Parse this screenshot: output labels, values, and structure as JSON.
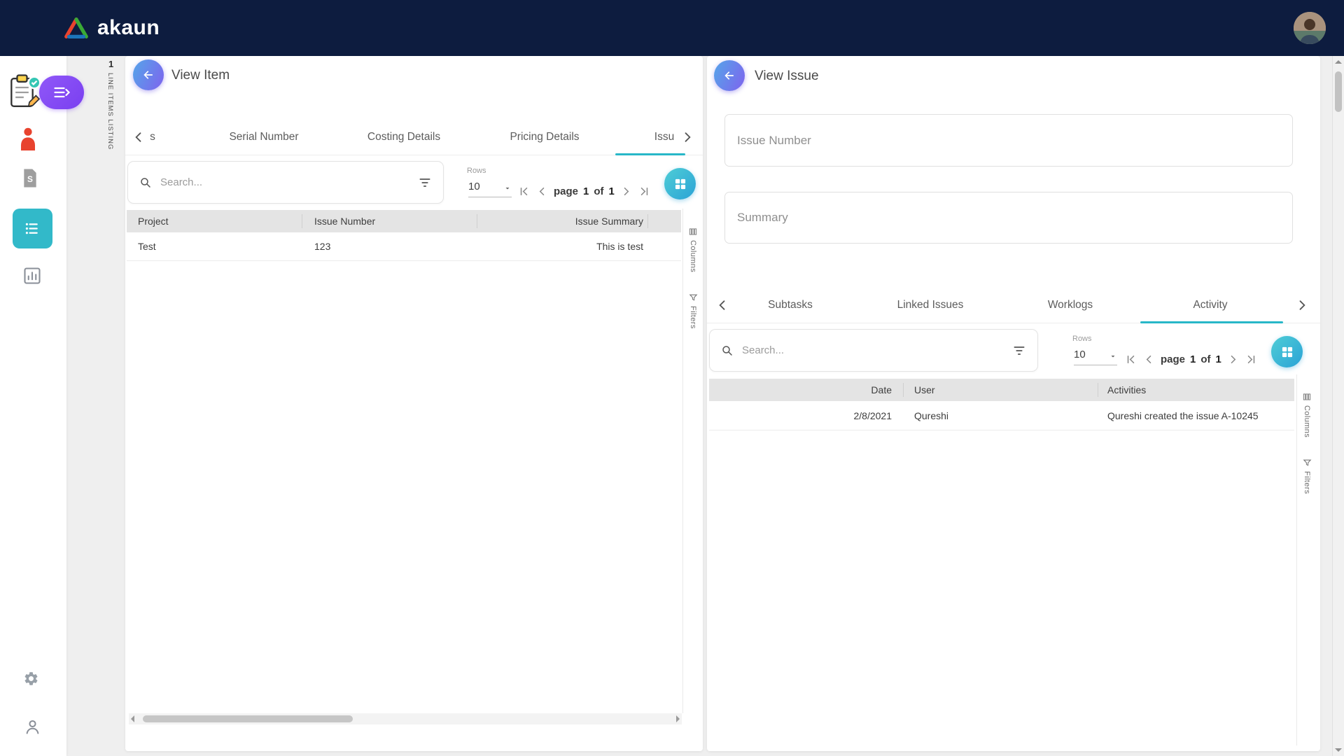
{
  "colors": {
    "header_bg": "#0d1c3f",
    "accent_teal": "#28b7c8",
    "accent_purple": "#7a3ff0",
    "back_button_gradient": [
      "#55a5e9",
      "#7e63ee"
    ],
    "grid_button_gradient": [
      "#4ecdd6",
      "#2ba3d6"
    ],
    "table_header_bg": "#e4e4e4"
  },
  "icons": {
    "header": [
      "triangle-logo",
      "user-avatar"
    ],
    "sidebar": [
      "clipboard-illustration",
      "menu-toggle",
      "red-person",
      "s-document",
      "list-menu",
      "bar-chart",
      "gear",
      "person-outline"
    ],
    "panel": [
      "arrow-left",
      "magnifier",
      "filter-lines",
      "grid-2x2",
      "first-page",
      "prev-page",
      "next-page",
      "last-page",
      "caret-down",
      "columns-bars",
      "filter-funnel"
    ]
  },
  "header": {
    "logo_text": "akaun"
  },
  "sidebar": {
    "badge_count": "1",
    "section_label": "LINE ITEMS LISTING"
  },
  "left_panel": {
    "title": "View Item",
    "tabs": [
      {
        "label": "s"
      },
      {
        "label": "Serial Number"
      },
      {
        "label": "Costing Details"
      },
      {
        "label": "Pricing Details"
      },
      {
        "label": "Issu",
        "active": true
      }
    ],
    "search_placeholder": "Search...",
    "rows_label": "Rows",
    "rows_value": "10",
    "pagination": {
      "word": "page",
      "current": "1",
      "of": "of",
      "total": "1"
    },
    "table": {
      "columns": [
        "Project",
        "Issue Number",
        "Issue Summary"
      ],
      "rows": [
        [
          "Test",
          "123",
          "This is test"
        ]
      ]
    },
    "rail": {
      "columns": "Columns",
      "filters": "Filters"
    }
  },
  "right_panel": {
    "title": "View Issue",
    "field_issue_number": "Issue Number",
    "field_summary": "Summary",
    "tabs": [
      {
        "label": "Subtasks"
      },
      {
        "label": "Linked Issues"
      },
      {
        "label": "Worklogs"
      },
      {
        "label": "Activity",
        "active": true
      }
    ],
    "search_placeholder": "Search...",
    "rows_label": "Rows",
    "rows_value": "10",
    "pagination": {
      "word": "page",
      "current": "1",
      "of": "of",
      "total": "1"
    },
    "table": {
      "columns": [
        "Date",
        "User",
        "Activities"
      ],
      "rows": [
        [
          "2/8/2021",
          "Qureshi",
          "Qureshi created the issue A-10245"
        ]
      ]
    },
    "rail": {
      "columns": "Columns",
      "filters": "Filters"
    }
  }
}
